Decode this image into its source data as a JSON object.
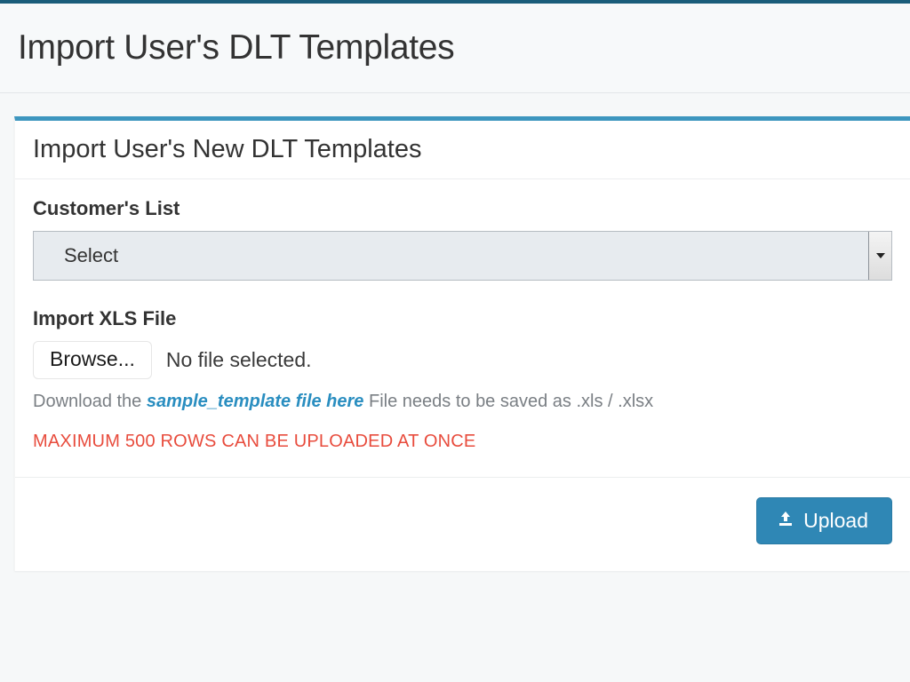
{
  "header": {
    "title": "Import User's DLT Templates"
  },
  "panel": {
    "title": "Import User's New DLT Templates",
    "customer_label": "Customer's List",
    "customer_select_value": "Select",
    "import_file_label": "Import XLS File",
    "browse_label": "Browse...",
    "no_file_text": "No file selected.",
    "hint_prefix": "Download the ",
    "hint_link": "sample_template file here",
    "hint_suffix": " File needs to be saved as .xls / .xlsx",
    "warning": "MAXIMUM 500 ROWS CAN BE UPLOADED AT ONCE",
    "upload_label": " Upload"
  }
}
